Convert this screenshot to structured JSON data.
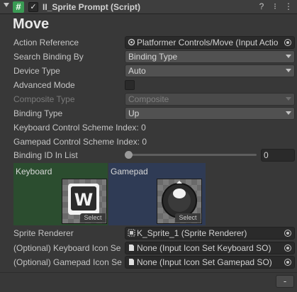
{
  "component": {
    "title": "II_Sprite Prompt (Script)",
    "enabled_check": "✓",
    "script_icon_glyph": "#",
    "help_icon": "?",
    "settings_icon": "⁝",
    "menu_icon": "⋮"
  },
  "heading": "Move",
  "fields": {
    "action_reference": {
      "label": "Action Reference",
      "value": "Platformer Controls/Move (Input Actio"
    },
    "search_binding_by": {
      "label": "Search Binding By",
      "value": "Binding Type"
    },
    "device_type": {
      "label": "Device Type",
      "value": "Auto"
    },
    "advanced_mode": {
      "label": "Advanced Mode"
    },
    "composite_type": {
      "label": "Composite Type",
      "value": "Composite"
    },
    "binding_type": {
      "label": "Binding Type",
      "value": "Up"
    },
    "keyboard_scheme": {
      "label": "Keyboard Control Scheme Index: 0"
    },
    "gamepad_scheme": {
      "label": "Gamepad Control Scheme Index: 0"
    },
    "binding_id": {
      "label": "Binding ID In List",
      "value": "0"
    },
    "sprite_renderer": {
      "label": "Sprite Renderer",
      "value": "K_Sprite_1 (Sprite Renderer)"
    },
    "keyboard_icon_set": {
      "label": "(Optional) Keyboard Icon Se",
      "value": "None (Input Icon Set Keyboard SO)"
    },
    "gamepad_icon_set": {
      "label": "(Optional) Gamepad Icon Se",
      "value": "None (Input Icon Set Gamepad SO)"
    }
  },
  "previews": {
    "keyboard": {
      "label": "Keyboard",
      "key_glyph": "W",
      "select": "Select"
    },
    "gamepad": {
      "label": "Gamepad",
      "select": "Select"
    }
  },
  "footer": {
    "remove_label": "-"
  },
  "colors": {
    "keyboard_panel": "#2b4d2f",
    "gamepad_panel": "#2f3b55",
    "script_icon": "#3a9b54"
  }
}
